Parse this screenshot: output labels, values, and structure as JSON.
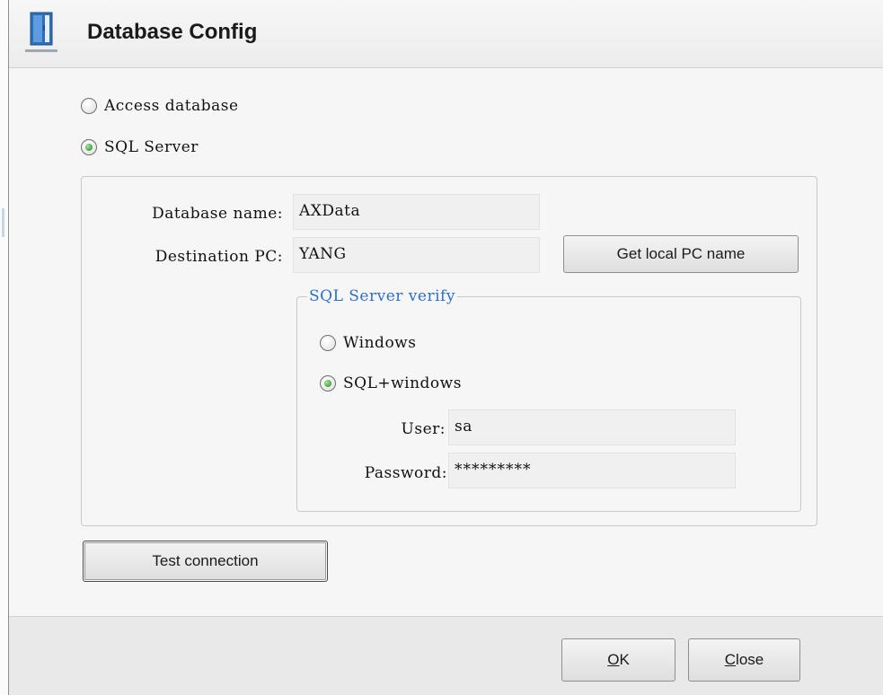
{
  "dialog": {
    "title": "Database Config",
    "icon": "door-icon"
  },
  "db_type": {
    "options": [
      {
        "label": "Access database",
        "selected": false
      },
      {
        "label": "SQL Server",
        "selected": true
      }
    ]
  },
  "sql_server": {
    "database_name_label": "Database name:",
    "database_name_value": "AXData",
    "destination_pc_label": "Destination PC:",
    "destination_pc_value": "YANG",
    "get_local_pc_button": "Get local PC name"
  },
  "verify": {
    "legend": "SQL Server verify",
    "options": [
      {
        "label": "Windows",
        "selected": false
      },
      {
        "label": "SQL+windows",
        "selected": true
      }
    ],
    "user_label": "User:",
    "user_value": "sa",
    "password_label": "Password:",
    "password_value": "*********"
  },
  "buttons": {
    "test_connection": "Test connection",
    "ok_mnemonic": "O",
    "ok_rest": "K",
    "close_mnemonic": "C",
    "close_rest": "lose"
  },
  "colors": {
    "legend_text": "#2a6fc9",
    "radio_selected": "#4fae4c",
    "icon_blue": "#2f6fb8"
  }
}
